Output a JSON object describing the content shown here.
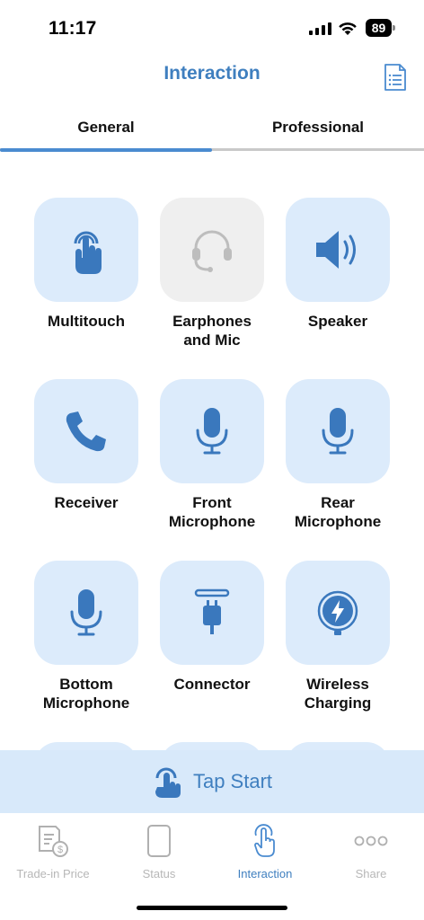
{
  "status_bar": {
    "time": "11:17",
    "battery": "89"
  },
  "header": {
    "title": "Interaction",
    "report_icon": "document-list-icon"
  },
  "tabs": [
    {
      "label": "General",
      "active": true
    },
    {
      "label": "Professional",
      "active": false
    }
  ],
  "tiles": [
    {
      "label": "Multitouch",
      "icon": "multitouch-hand-icon",
      "enabled": true
    },
    {
      "label": "Earphones and Mic",
      "icon": "headset-icon",
      "enabled": false
    },
    {
      "label": "Speaker",
      "icon": "speaker-icon",
      "enabled": true
    },
    {
      "label": "Receiver",
      "icon": "phone-receiver-icon",
      "enabled": true
    },
    {
      "label": "Front Microphone",
      "icon": "microphone-icon",
      "enabled": true
    },
    {
      "label": "Rear Microphone",
      "icon": "microphone-icon",
      "enabled": true
    },
    {
      "label": "Bottom Microphone",
      "icon": "microphone-icon",
      "enabled": true
    },
    {
      "label": "Connector",
      "icon": "connector-icon",
      "enabled": true
    },
    {
      "label": "Wireless Charging",
      "icon": "wireless-charging-icon",
      "enabled": true
    }
  ],
  "start_button": {
    "label": "Tap Start",
    "icon": "tap-hand-icon"
  },
  "bottom_nav": [
    {
      "label": "Trade-in Price",
      "icon": "price-document-icon",
      "active": false
    },
    {
      "label": "Status",
      "icon": "phone-outline-icon",
      "active": false
    },
    {
      "label": "Interaction",
      "icon": "tap-finger-icon",
      "active": true
    },
    {
      "label": "Share",
      "icon": "more-dots-icon",
      "active": false
    }
  ],
  "colors": {
    "accent": "#3f7fbf",
    "tile_bg": "#dcebfb",
    "tile_disabled_bg": "#efefef",
    "icon_blue": "#3a78bd"
  }
}
